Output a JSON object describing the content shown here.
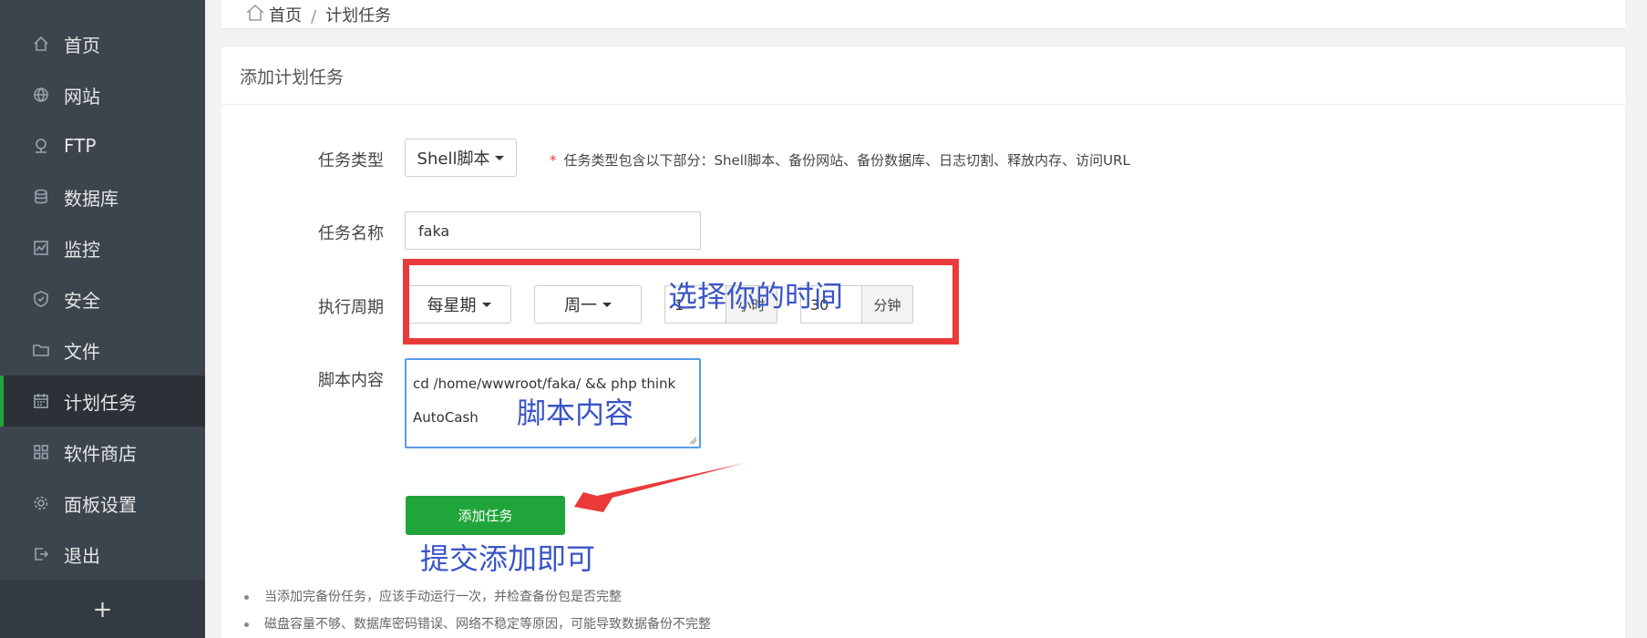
{
  "sidebar": {
    "items": [
      {
        "label": "首页",
        "icon": "home-icon"
      },
      {
        "label": "网站",
        "icon": "globe-icon"
      },
      {
        "label": "FTP",
        "icon": "ftp-icon"
      },
      {
        "label": "数据库",
        "icon": "database-icon"
      },
      {
        "label": "监控",
        "icon": "monitor-icon"
      },
      {
        "label": "安全",
        "icon": "shield-icon"
      },
      {
        "label": "文件",
        "icon": "folder-icon"
      },
      {
        "label": "计划任务",
        "icon": "calendar-icon",
        "active": true
      },
      {
        "label": "软件商店",
        "icon": "grid-icon"
      },
      {
        "label": "面板设置",
        "icon": "gear-icon"
      },
      {
        "label": "退出",
        "icon": "logout-icon"
      }
    ],
    "add_label": "+"
  },
  "breadcrumb": {
    "home": "首页",
    "separator": "/",
    "current": "计划任务"
  },
  "panel": {
    "title": "添加计划任务"
  },
  "form": {
    "task_type_label": "任务类型",
    "task_type_value": "Shell脚本",
    "task_type_hint_star": "*",
    "task_type_hint": "任务类型包含以下部分：Shell脚本、备份网站、备份数据库、日志切割、释放内存、访问URL",
    "task_name_label": "任务名称",
    "task_name_value": "faka",
    "cycle_label": "执行周期",
    "cycle_value": "每星期",
    "weekday_value": "周一",
    "hour_value": "1",
    "hour_unit": "小时",
    "minute_value": "30",
    "minute_unit": "分钟",
    "script_label": "脚本内容",
    "script_line1": "cd /home/wwwroot/faka/ && php think",
    "script_line2": "AutoCash",
    "submit_label": "添加任务"
  },
  "notes": [
    "当添加完备份任务，应该手动运行一次，并检查备份包是否完整",
    "磁盘容量不够、数据库密码错误、网络不稳定等原因，可能导致数据备份不完整"
  ],
  "annotations": {
    "time": "选择你的时间",
    "script": "脚本内容",
    "submit": "提交添加即可"
  },
  "colors": {
    "sidebar_bg": "#3c444d",
    "accent_green": "#20a53a",
    "annotation_red": "#ea3a3a",
    "annotation_blue": "#3a55c7"
  }
}
